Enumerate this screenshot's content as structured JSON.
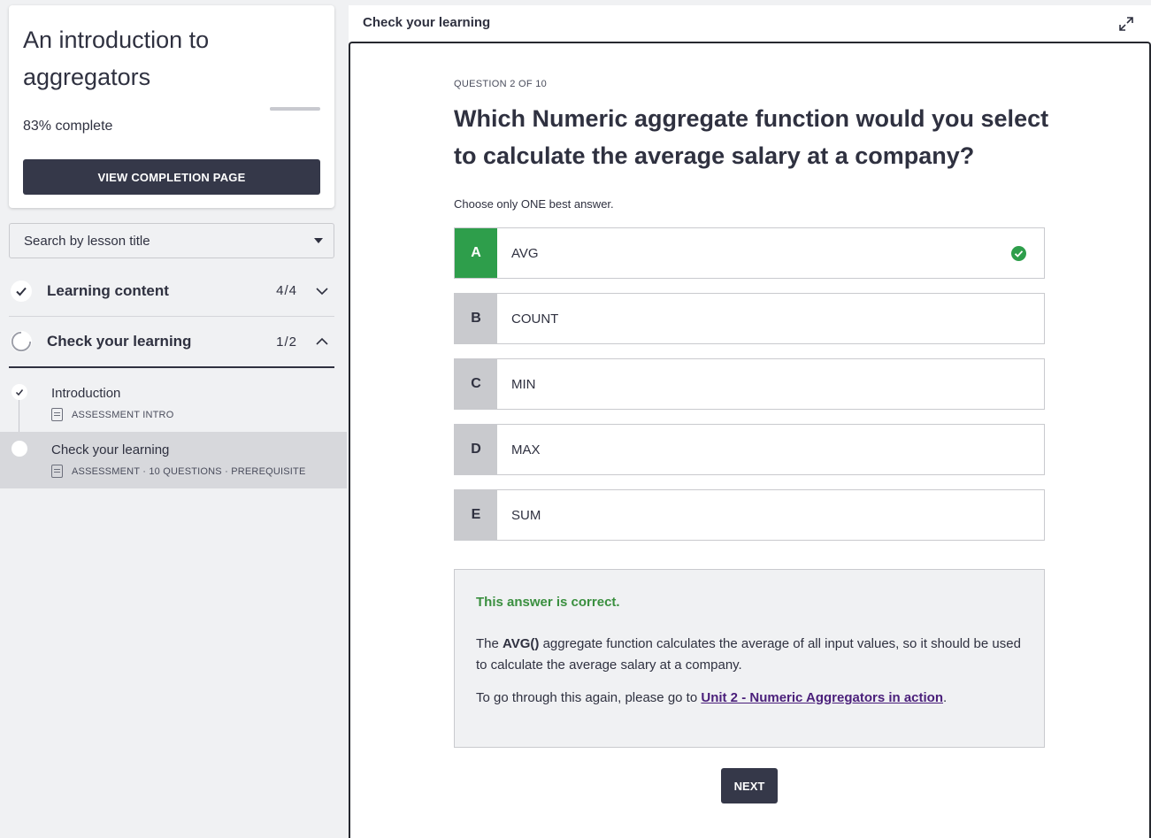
{
  "course": {
    "title": "An introduction to aggregators",
    "percent": "83%",
    "complete_label": "complete",
    "progress_fraction": 0.83,
    "view_completion_label": "VIEW COMPLETION PAGE"
  },
  "search": {
    "placeholder": "Search by lesson title"
  },
  "sections": [
    {
      "label": "Learning content",
      "count": "4/4",
      "expanded": false,
      "status": "complete"
    },
    {
      "label": "Check your learning",
      "count": "1/2",
      "expanded": true,
      "status": "in-progress"
    }
  ],
  "lessons": [
    {
      "title": "Introduction",
      "meta": "ASSESSMENT INTRO",
      "status": "complete"
    },
    {
      "title": "Check your learning",
      "meta": "ASSESSMENT · 10 QUESTIONS · PREREQUISITE",
      "status": "current"
    }
  ],
  "main": {
    "header_title": "Check your learning",
    "question_number": "QUESTION 2 OF 10",
    "question_text": "Which Numeric aggregate function would you select to calculate the average salary at a company?",
    "instruction": "Choose only ONE best answer.",
    "options": [
      {
        "letter": "A",
        "text": "AVG",
        "correct": true
      },
      {
        "letter": "B",
        "text": "COUNT",
        "correct": false
      },
      {
        "letter": "C",
        "text": "MIN",
        "correct": false
      },
      {
        "letter": "D",
        "text": "MAX",
        "correct": false
      },
      {
        "letter": "E",
        "text": "SUM",
        "correct": false
      }
    ],
    "feedback": {
      "status": "This answer is correct.",
      "body_pre": "The ",
      "body_bold": "AVG()",
      "body_post": " aggregate function calculates the average of all input values, so it should be used to calculate the average salary at a company.",
      "link_pre": "To go through this again, please go to ",
      "link_text": "Unit 2 - Numeric Aggregators in action",
      "link_post": "."
    },
    "next_label": "NEXT"
  },
  "colors": {
    "primary_dark": "#353849",
    "correct_green": "#2e9e4b",
    "correct_text": "#3a8f3f",
    "link_purple": "#4a1f7a"
  },
  "icons": [
    "check-icon",
    "spinner-icon",
    "chevron-down-icon",
    "chevron-up-icon",
    "caret-down-icon",
    "expand-icon",
    "document-icon",
    "check-circle-icon"
  ]
}
